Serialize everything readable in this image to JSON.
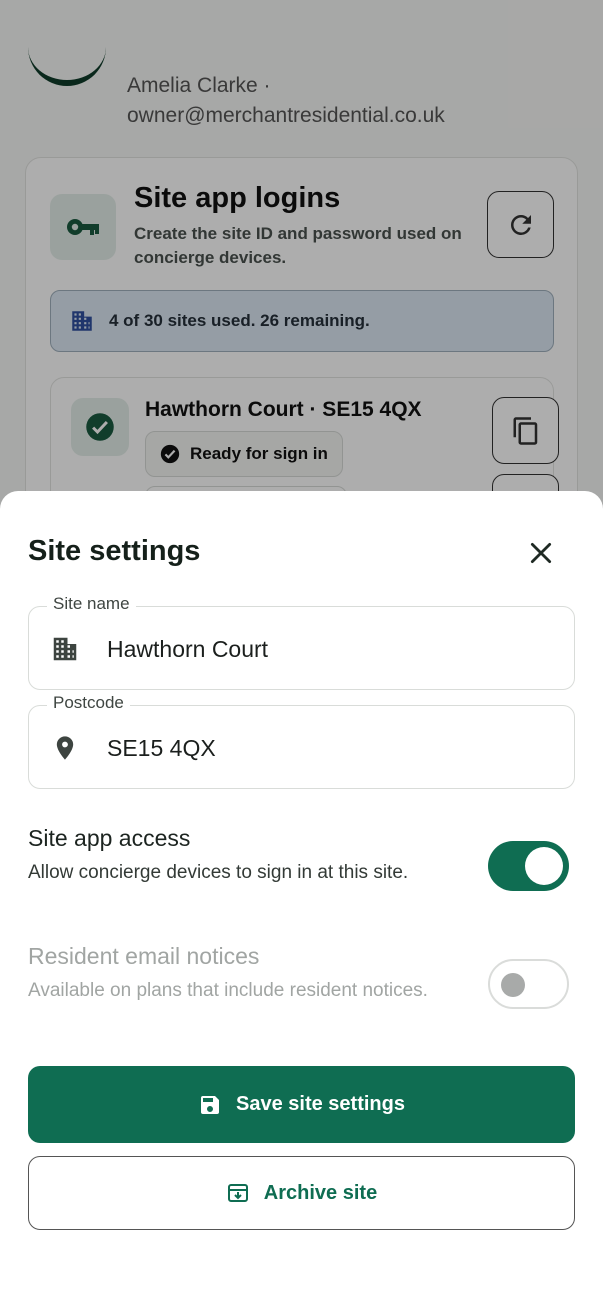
{
  "colors": {
    "primary": "#0f6d52",
    "primary_text": "#ffffff",
    "info_bg": "#dce8f3",
    "disabled_text": "#a1a5a3"
  },
  "background": {
    "account": {
      "name": "Amelia Clarke ·",
      "email": "owner@merchantresidential.co.uk"
    },
    "logins_card": {
      "title": "Site app logins",
      "description": "Create the site ID and password used on concierge devices.",
      "icon": "key-icon",
      "refresh_icon": "refresh-icon",
      "usage": "4 of 30 sites used. 26 remaining.",
      "usage_icon": "building-icon"
    },
    "site_card": {
      "title": "Hawthorn Court · SE15 4QX",
      "status": "Ready for sign in",
      "status_icon": "check-circle-icon",
      "copy_icon": "copy-icon"
    }
  },
  "sheet": {
    "title": "Site settings",
    "close_icon": "close-icon",
    "site_name": {
      "label": "Site name",
      "value": "Hawthorn Court",
      "icon": "building-icon"
    },
    "postcode": {
      "label": "Postcode",
      "value": "SE15 4QX",
      "icon": "location-pin-icon"
    },
    "site_app_access": {
      "title": "Site app access",
      "description": "Allow concierge devices to sign in at this site.",
      "enabled": true
    },
    "resident_email": {
      "title": "Resident email notices",
      "description": "Available on plans that include resident notices.",
      "enabled": false,
      "disabled": true
    },
    "save_label": "Save site settings",
    "save_icon": "save-icon",
    "archive_label": "Archive site",
    "archive_icon": "archive-icon"
  }
}
